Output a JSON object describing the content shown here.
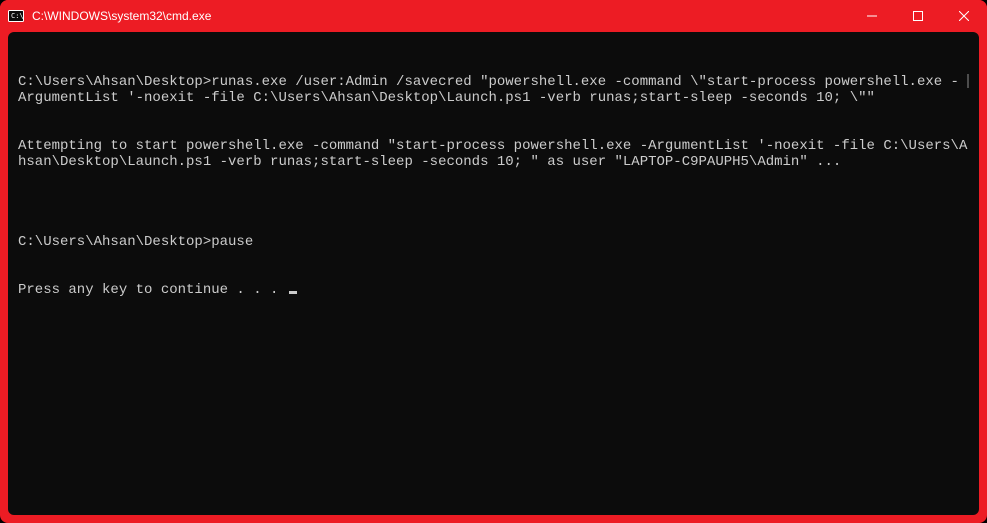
{
  "window": {
    "title": "C:\\WINDOWS\\system32\\cmd.exe"
  },
  "icons": {
    "app": "cmd-icon",
    "minimize": "minimize-icon",
    "maximize": "maximize-icon",
    "close": "close-icon"
  },
  "terminal": {
    "lines": [
      "C:\\Users\\Ahsan\\Desktop>runas.exe /user:Admin /savecred \"powershell.exe -command \\\"start-process powershell.exe -ArgumentList '-noexit -file C:\\Users\\Ahsan\\Desktop\\Launch.ps1 -verb runas;start-sleep -seconds 10; \\\"\"",
      "Attempting to start powershell.exe -command \"start-process powershell.exe -ArgumentList '-noexit -file C:\\Users\\Ahsan\\Desktop\\Launch.ps1 -verb runas;start-sleep -seconds 10; \" as user \"LAPTOP-C9PAUPH5\\Admin\" ...",
      "",
      "C:\\Users\\Ahsan\\Desktop>pause",
      "Press any key to continue . . . "
    ]
  }
}
